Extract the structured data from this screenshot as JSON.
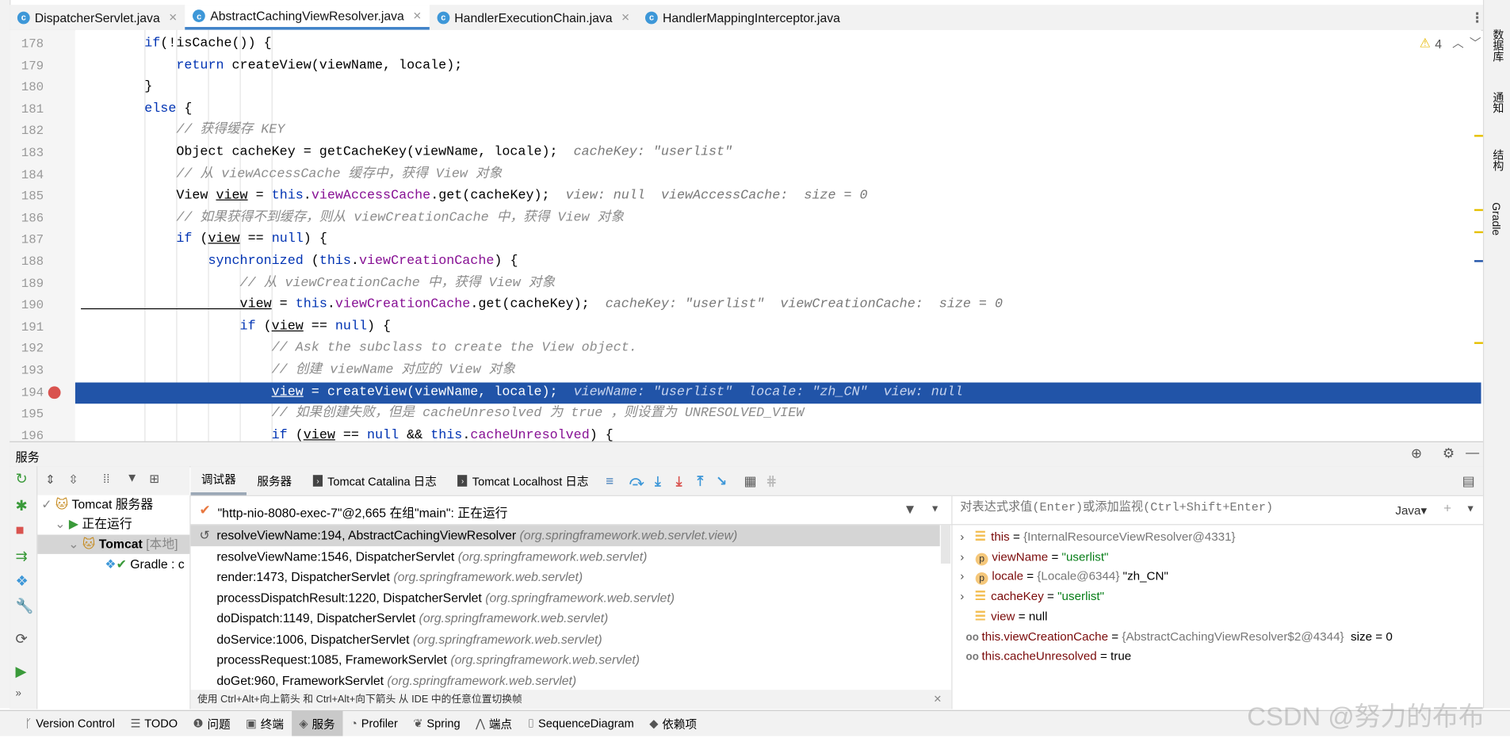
{
  "tabs": [
    {
      "label": "DispatcherServlet.java",
      "active": false
    },
    {
      "label": "AbstractCachingViewResolver.java",
      "active": true
    },
    {
      "label": "HandlerExecutionChain.java",
      "active": false
    },
    {
      "label": "HandlerMappingInterceptor.java",
      "active": false
    }
  ],
  "editor": {
    "warning_count": "4",
    "breakpoint_line": "194",
    "lines": [
      {
        "n": "178",
        "code": [
          [
            "kw",
            "        if"
          ],
          [
            "",
            "(!isCache()) {"
          ]
        ],
        "hints": []
      },
      {
        "n": "179",
        "code": [
          [
            "kw",
            "            return"
          ],
          [
            "",
            " createView(viewName, locale);"
          ]
        ],
        "hints": []
      },
      {
        "n": "180",
        "code": [
          [
            "",
            "        }"
          ]
        ],
        "hints": []
      },
      {
        "n": "181",
        "code": [
          [
            "kw",
            "        else"
          ],
          [
            "",
            " {"
          ]
        ],
        "hints": []
      },
      {
        "n": "182",
        "code": [
          [
            "cm",
            "            // 获得缓存 KEY"
          ]
        ],
        "hints": []
      },
      {
        "n": "183",
        "code": [
          [
            "",
            "            Object cacheKey = getCacheKey(viewName, locale);"
          ]
        ],
        "hints": [
          "cacheKey: \"userlist\""
        ]
      },
      {
        "n": "184",
        "code": [
          [
            "cm",
            "            // 从 viewAccessCache 缓存中，获得 View 对象"
          ]
        ],
        "hints": []
      },
      {
        "n": "185",
        "code": [
          [
            "",
            "            View "
          ],
          [
            "ul",
            "view"
          ],
          [
            "",
            " = "
          ],
          [
            "kw",
            "this"
          ],
          [
            "",
            "."
          ],
          [
            "fld",
            "viewAccessCache"
          ],
          [
            "",
            ".get(cacheKey);"
          ]
        ],
        "hints": [
          "view: null",
          "viewAccessCache:  size = 0"
        ]
      },
      {
        "n": "186",
        "code": [
          [
            "cm",
            "            // 如果获得不到缓存，则从 viewCreationCache 中，获得 View 对象"
          ]
        ],
        "hints": []
      },
      {
        "n": "187",
        "code": [
          [
            "kw",
            "            if"
          ],
          [
            "",
            " ("
          ],
          [
            "ul",
            "view"
          ],
          [
            "",
            " == "
          ],
          [
            "kw",
            "null"
          ],
          [
            "",
            ") {"
          ]
        ],
        "hints": []
      },
      {
        "n": "188",
        "code": [
          [
            "kw",
            "                synchronized"
          ],
          [
            "",
            " ("
          ],
          [
            "kw",
            "this"
          ],
          [
            "",
            "."
          ],
          [
            "fld",
            "viewCreationCache"
          ],
          [
            "",
            ") {"
          ]
        ],
        "hints": []
      },
      {
        "n": "189",
        "code": [
          [
            "cm",
            "                    // 从 viewCreationCache 中，获得 View 对象"
          ]
        ],
        "hints": []
      },
      {
        "n": "190",
        "code": [
          [
            "ul",
            "                    view"
          ],
          [
            "",
            " = "
          ],
          [
            "kw",
            "this"
          ],
          [
            "",
            "."
          ],
          [
            "fld",
            "viewCreationCache"
          ],
          [
            "",
            ".get(cacheKey);"
          ]
        ],
        "hints": [
          "cacheKey: \"userlist\"",
          "viewCreationCache:  size = 0"
        ]
      },
      {
        "n": "191",
        "code": [
          [
            "kw",
            "                    if"
          ],
          [
            "",
            " ("
          ],
          [
            "ul",
            "view"
          ],
          [
            "",
            " == "
          ],
          [
            "kw",
            "null"
          ],
          [
            "",
            ") {"
          ]
        ],
        "hints": []
      },
      {
        "n": "192",
        "code": [
          [
            "cm",
            "                        // Ask the subclass to create the View object."
          ]
        ],
        "hints": []
      },
      {
        "n": "193",
        "code": [
          [
            "cm",
            "                        // 创建 viewName 对应的 View 对象"
          ]
        ],
        "hints": []
      },
      {
        "n": "194",
        "code": [
          [
            "",
            "                        "
          ],
          [
            "ul",
            "view"
          ],
          [
            "",
            " = createView(viewName, locale);"
          ]
        ],
        "hints": [
          "viewName: \"userlist\"",
          "locale: \"zh_CN\"",
          "view: null"
        ],
        "current": true
      },
      {
        "n": "195",
        "code": [
          [
            "cm",
            "                        // 如果创建失败，但是 cacheUnresolved 为 true ，则设置为 UNRESOLVED_VIEW"
          ]
        ],
        "hints": []
      },
      {
        "n": "196",
        "code": [
          [
            "kw",
            "                        if"
          ],
          [
            "",
            " ("
          ],
          [
            "ul",
            "view"
          ],
          [
            "",
            " == "
          ],
          [
            "kw",
            "null"
          ],
          [
            "",
            " && "
          ],
          [
            "kw",
            "this"
          ],
          [
            "",
            "."
          ],
          [
            "fld",
            "cacheUnresolved"
          ],
          [
            "",
            ") {"
          ]
        ],
        "hints": []
      }
    ]
  },
  "right_sidebar": [
    "数据库",
    "通知",
    "结构",
    "Gradle"
  ],
  "services": {
    "title": "服务",
    "tree": [
      {
        "label": "Tomcat 服务器"
      },
      {
        "label": "正在运行"
      },
      {
        "label": "Tomcat",
        "suffix": "[本地]"
      },
      {
        "label": "Gradle : c"
      }
    ],
    "debug_tabs": [
      "调试器",
      "服务器",
      "Tomcat Catalina 日志",
      "Tomcat Localhost 日志"
    ],
    "thread": "\"http-nio-8080-exec-7\"@2,665 在组\"main\": 正在运行",
    "frames": [
      {
        "method": "resolveViewName:194, AbstractCachingViewResolver",
        "pkg": "(org.springframework.web.servlet.view)"
      },
      {
        "method": "resolveViewName:1546, DispatcherServlet",
        "pkg": "(org.springframework.web.servlet)"
      },
      {
        "method": "render:1473, DispatcherServlet",
        "pkg": "(org.springframework.web.servlet)"
      },
      {
        "method": "processDispatchResult:1220, DispatcherServlet",
        "pkg": "(org.springframework.web.servlet)"
      },
      {
        "method": "doDispatch:1149, DispatcherServlet",
        "pkg": "(org.springframework.web.servlet)"
      },
      {
        "method": "doService:1006, DispatcherServlet",
        "pkg": "(org.springframework.web.servlet)"
      },
      {
        "method": "processRequest:1085, FrameworkServlet",
        "pkg": "(org.springframework.web.servlet)"
      },
      {
        "method": "doGet:960, FrameworkServlet",
        "pkg": "(org.springframework.web.servlet)"
      }
    ],
    "tip": "使用 Ctrl+Alt+向上箭头 和 Ctrl+Alt+向下箭头 从 IDE 中的任意位置切换帧",
    "eval_placeholder": "对表达式求值(Enter)或添加监视(Ctrl+Shift+Enter)",
    "lang": "Java",
    "vars": [
      {
        "icon": "field",
        "name": "this",
        "eq": " = ",
        "ref": "{InternalResourceViewResolver@4331}",
        "val": "",
        "str": "",
        "expandable": true
      },
      {
        "icon": "param",
        "name": "viewName",
        "eq": " = ",
        "ref": "",
        "val": "",
        "str": "\"userlist\"",
        "expandable": true
      },
      {
        "icon": "param",
        "name": "locale",
        "eq": " = ",
        "ref": "{Locale@6344}",
        "val": " \"zh_CN\"",
        "str": "",
        "expandable": true
      },
      {
        "icon": "field",
        "name": "cacheKey",
        "eq": " = ",
        "ref": "",
        "val": "",
        "str": "\"userlist\"",
        "expandable": true
      },
      {
        "icon": "field",
        "name": "view",
        "eq": " = ",
        "ref": "",
        "val": "null",
        "str": "",
        "expandable": false
      },
      {
        "icon": "watch",
        "name": "this.viewCreationCache",
        "eq": " = ",
        "ref": "{AbstractCachingViewResolver$2@4344}",
        "val": "  size = 0",
        "str": "",
        "expandable": false
      },
      {
        "icon": "watch",
        "name": "this.cacheUnresolved",
        "eq": " = ",
        "ref": "",
        "val": "true",
        "str": "",
        "expandable": false
      }
    ]
  },
  "statusbar": [
    {
      "label": "Version Control",
      "icon": "branch-icon"
    },
    {
      "label": "TODO",
      "icon": "list-icon"
    },
    {
      "label": "问题",
      "icon": "problems-icon"
    },
    {
      "label": "终端",
      "icon": "terminal-icon"
    },
    {
      "label": "服务",
      "icon": "services-icon",
      "active": true
    },
    {
      "label": "Profiler",
      "icon": "profiler-icon"
    },
    {
      "label": "Spring",
      "icon": "spring-icon"
    },
    {
      "label": "端点",
      "icon": "endpoints-icon"
    },
    {
      "label": "SequenceDiagram",
      "icon": "sequence-icon"
    },
    {
      "label": "依赖项",
      "icon": "dependencies-icon"
    }
  ],
  "watermark": "CSDN @努力的布布",
  "colors": {
    "selection": "#2154a8",
    "keyword": "#0033b3",
    "field": "#871094",
    "accent": "#4083c9"
  }
}
